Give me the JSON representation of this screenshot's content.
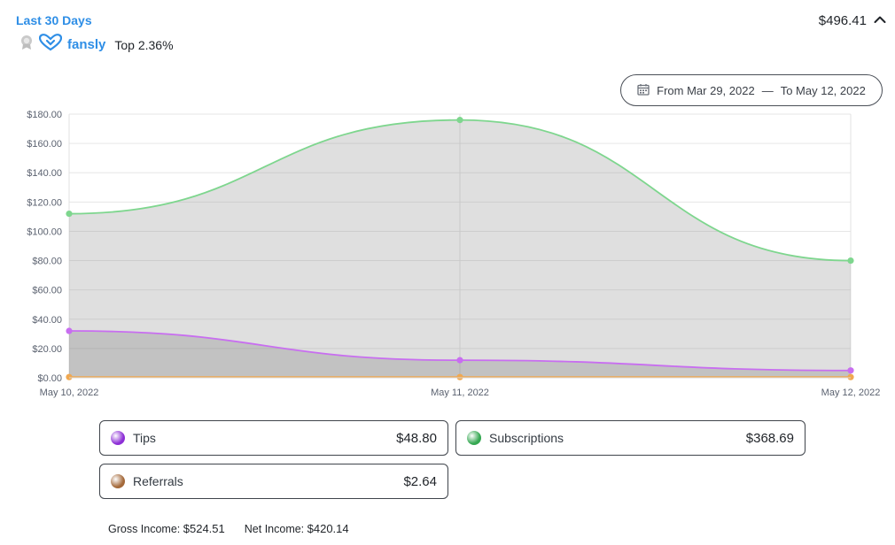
{
  "header": {
    "period_label": "Last 30 Days",
    "brand_name": "fansly",
    "rank_text": "Top 2.36%",
    "total": "$496.41"
  },
  "date_range": {
    "from_text": "From Mar 29, 2022",
    "separator": "—",
    "to_text": "To May 12, 2022"
  },
  "chart_data": {
    "type": "area",
    "x": [
      "May 10, 2022",
      "May 11, 2022",
      "May 12, 2022"
    ],
    "y_ticks": [
      "$0.00",
      "$20.00",
      "$40.00",
      "$60.00",
      "$80.00",
      "$100.00",
      "$120.00",
      "$140.00",
      "$160.00",
      "$180.00"
    ],
    "ylim": [
      0,
      180
    ],
    "grid": true,
    "series": [
      {
        "name": "Subscriptions",
        "color": "#7ed68e",
        "values": [
          112,
          176,
          80
        ]
      },
      {
        "name": "Tips",
        "color": "#c86ef0",
        "values": [
          32,
          12,
          5
        ]
      },
      {
        "name": "Referrals",
        "color": "#f0a850",
        "values": [
          0.5,
          0.5,
          0.5
        ]
      }
    ]
  },
  "summary": {
    "tips": {
      "label": "Tips",
      "value": "$48.80",
      "color": "#8d2fd6"
    },
    "subscriptions": {
      "label": "Subscriptions",
      "value": "$368.69",
      "color": "#35a852"
    },
    "referrals": {
      "label": "Referrals",
      "value": "$2.64",
      "color": "#a4693a"
    }
  },
  "income": {
    "gross_label": "Gross Income:",
    "gross_value": "$524.51",
    "net_label": "Net Income:",
    "net_value": "$420.14"
  }
}
